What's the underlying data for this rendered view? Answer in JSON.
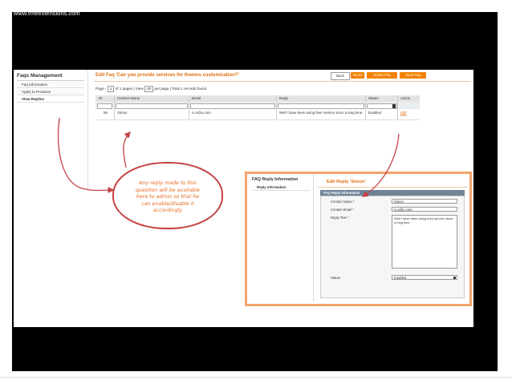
{
  "site": {
    "url": "www.fmeextensions.com"
  },
  "sidebar": {
    "title": "Faqs Management",
    "items": [
      {
        "label": "Faq Information"
      },
      {
        "label": "Apply to Products"
      },
      {
        "label": "View Replies"
      }
    ]
  },
  "header": {
    "title": "Edit Faq 'Can you provide services for themes customization?'",
    "buttons": {
      "back": "Back",
      "reset": "Reset",
      "delete": "Delete Faq",
      "save": "Save Faq"
    }
  },
  "pager": {
    "page_label": "Page",
    "page_value": "1",
    "of_pages": "of 1 pages",
    "view_label": "View",
    "per_page_value": "20",
    "per_page_label": "per page",
    "total": "Total 1 records found"
  },
  "grid": {
    "columns": [
      "ID",
      "Contact Name",
      "Email",
      "Reply",
      "Status",
      "Action"
    ],
    "rows": [
      {
        "id": "56",
        "name": "Simon",
        "email": "s.ro@u.com",
        "reply": "Well i have been using their service since a long time.",
        "status": "Enabled",
        "action": "Edit"
      }
    ]
  },
  "callout": {
    "lines": [
      "Any reply made to this",
      "question will be available",
      "here to admin  so that he",
      "can enable/disable it",
      "accordingly"
    ]
  },
  "reply_panel": {
    "sidebar_title": "FAQ Reply Information",
    "sidebar_item": "Reply Information",
    "title": "Edit Reply 'Simon'",
    "fieldset_title": "FAQ Reply Information",
    "fields": {
      "contact_name_label": "Contact Name *",
      "contact_name_value": "Simon",
      "contact_email_label": "Contact Email *",
      "contact_email_value": "s.ro@u.com",
      "reply_text_label": "Reply Text *",
      "reply_text_value": "Well i have been using their service since a long time.",
      "status_label": "Status",
      "status_value": "Enabled"
    }
  },
  "colors": {
    "accent": "#f18200",
    "arrow": "#c44242",
    "panel_border": "#f4a36c"
  }
}
